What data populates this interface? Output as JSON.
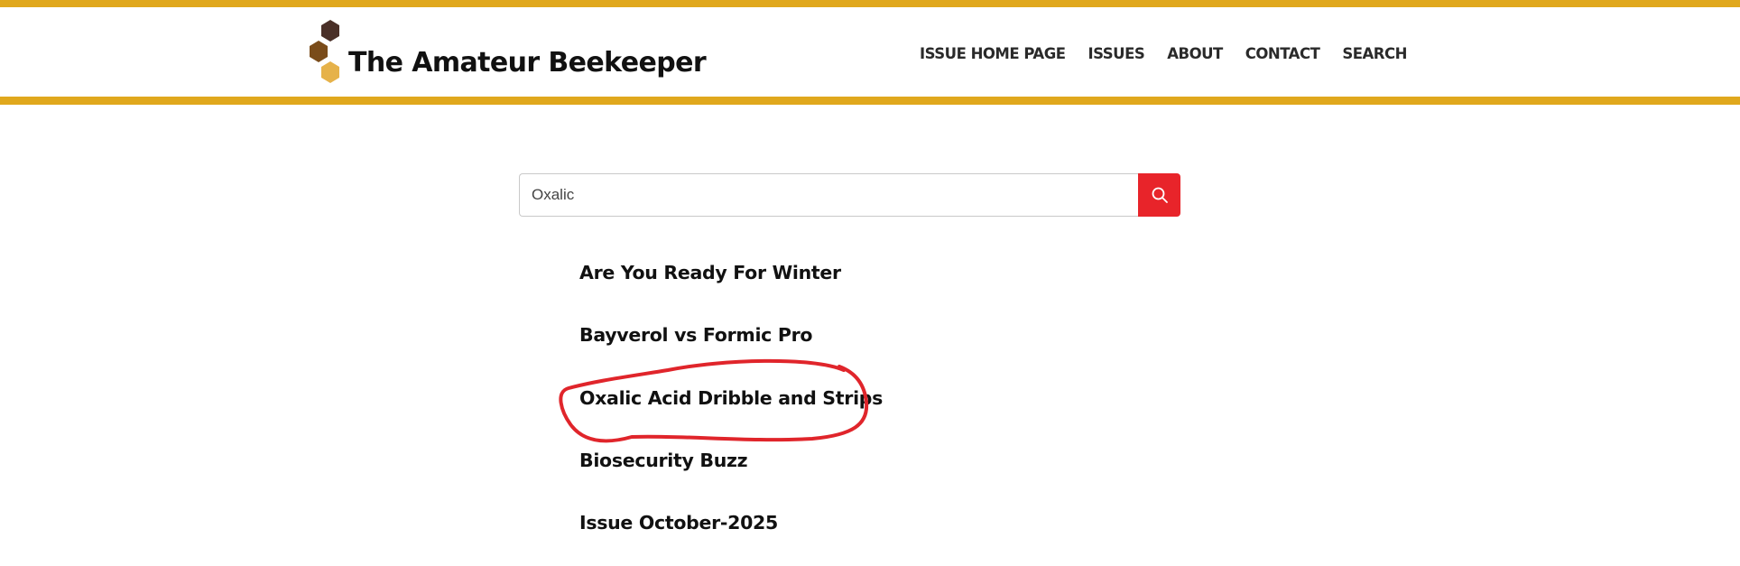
{
  "site": {
    "title": "The Amateur Beekeeper",
    "brand_color": "#e0a81d",
    "logo_colors": [
      "#4a3028",
      "#7a4c1a",
      "#e6b24a"
    ]
  },
  "nav": {
    "items": [
      {
        "label": "ISSUE HOME PAGE"
      },
      {
        "label": "ISSUES"
      },
      {
        "label": "ABOUT"
      },
      {
        "label": "CONTACT"
      },
      {
        "label": "SEARCH"
      }
    ]
  },
  "search": {
    "value": "Oxalic",
    "button_icon": "search-icon",
    "button_color": "#e8242a"
  },
  "results": [
    {
      "title": "Are You Ready For Winter"
    },
    {
      "title": "Bayverol vs Formic Pro"
    },
    {
      "title": "Oxalic Acid Dribble and Strips",
      "highlighted": true
    },
    {
      "title": "Biosecurity Buzz"
    },
    {
      "title": "Issue October-2025"
    }
  ],
  "annotation": {
    "type": "hand-drawn circle",
    "color": "#e0252b",
    "target": "Oxalic Acid Dribble and Strips"
  }
}
